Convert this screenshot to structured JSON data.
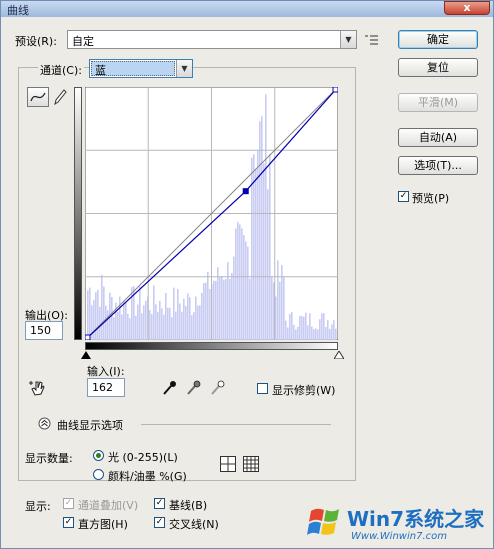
{
  "window": {
    "title": "曲线",
    "close_label": "x"
  },
  "preset": {
    "label": "预设(R):",
    "value": "自定"
  },
  "channel": {
    "label": "通道(C):",
    "value": "蓝"
  },
  "buttons": {
    "ok": "确定",
    "reset": "复位",
    "smooth": "平滑(M)",
    "auto": "自动(A)",
    "options": "选项(T)..."
  },
  "preview": {
    "label": "预览(P)",
    "checked": true
  },
  "output": {
    "label": "输出(O):",
    "value": "150"
  },
  "input": {
    "label": "输入(I):",
    "value": "162"
  },
  "show_clipping": {
    "label": "显示修剪(W)",
    "checked": false
  },
  "curve_display_options": {
    "label": "曲线显示选项"
  },
  "show_amount": {
    "label": "显示数量:",
    "light": "光 (0-255)(L)",
    "pigment": "颜料/油墨 %(G)"
  },
  "show": {
    "label": "显示:",
    "channel_overlays": "通道叠加(V)",
    "baseline": "基线(B)",
    "histogram": "直方图(H)",
    "intersection": "交叉线(N)"
  },
  "watermark": {
    "text": "Win7系统之家",
    "url": "Www.Winwin7.com"
  },
  "colors": {
    "histogram": "#c8ccf2",
    "curve": "#0000b0",
    "accent": "#3c7fb1"
  },
  "chart_data": {
    "type": "line",
    "title": "",
    "xlabel": "",
    "ylabel": "",
    "xlim": [
      0,
      255
    ],
    "ylim": [
      0,
      255
    ],
    "grid": true,
    "series": [
      {
        "x": [
          0,
          162,
          255
        ],
        "y": [
          0,
          150,
          255
        ]
      }
    ]
  }
}
